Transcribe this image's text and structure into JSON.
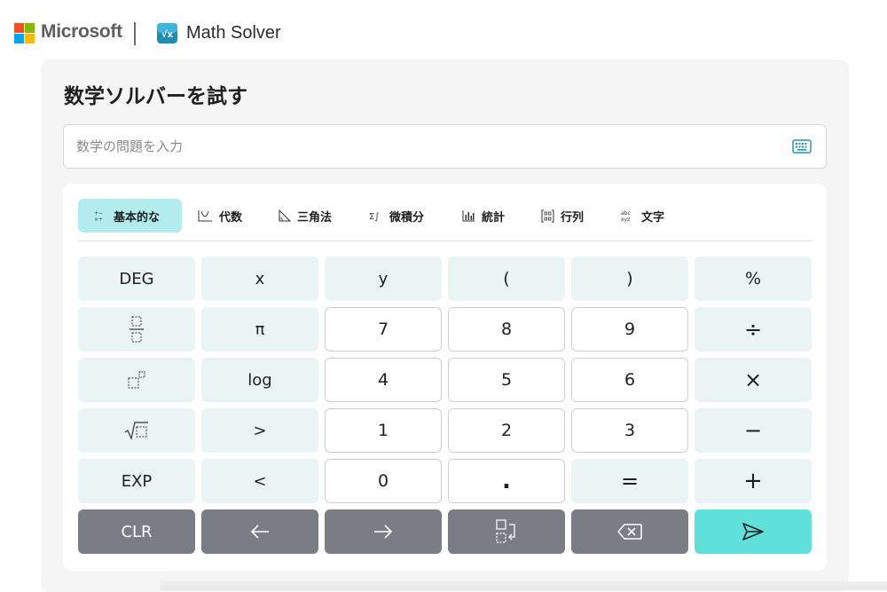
{
  "header": {
    "brand": "Microsoft",
    "app_name": "Math Solver",
    "logo_colors": [
      "#f25022",
      "#7fba00",
      "#00a4ef",
      "#ffb900"
    ]
  },
  "main": {
    "title": "数学ソルバーを試す",
    "search_placeholder": "数学の問題を入力"
  },
  "tabs": [
    {
      "label": "基本的な",
      "icon": "basic-ops-icon",
      "active": true
    },
    {
      "label": "代数",
      "icon": "algebra-icon",
      "active": false
    },
    {
      "label": "三角法",
      "icon": "trig-icon",
      "active": false
    },
    {
      "label": "微積分",
      "icon": "calculus-icon",
      "active": false
    },
    {
      "label": "統計",
      "icon": "stats-icon",
      "active": false
    },
    {
      "label": "行列",
      "icon": "matrix-icon",
      "active": false
    },
    {
      "label": "文字",
      "icon": "letters-icon",
      "active": false
    }
  ],
  "keys": {
    "r1": [
      "DEG",
      "x",
      "y",
      "(",
      ")",
      "%"
    ],
    "r2": [
      "π",
      "7",
      "8",
      "9",
      "÷"
    ],
    "r3": [
      "log",
      "4",
      "5",
      "6",
      "×"
    ],
    "r4": [
      ">",
      "1",
      "2",
      "3",
      "−"
    ],
    "r5": [
      "EXP",
      "<",
      "0",
      ".",
      "=",
      "+"
    ],
    "r6": [
      "CLR"
    ]
  },
  "colors": {
    "accent": "#5fe0da",
    "tab_active": "#b3ecec",
    "key_fn": "#eaf4f4",
    "key_dark": "#7a7d83"
  }
}
